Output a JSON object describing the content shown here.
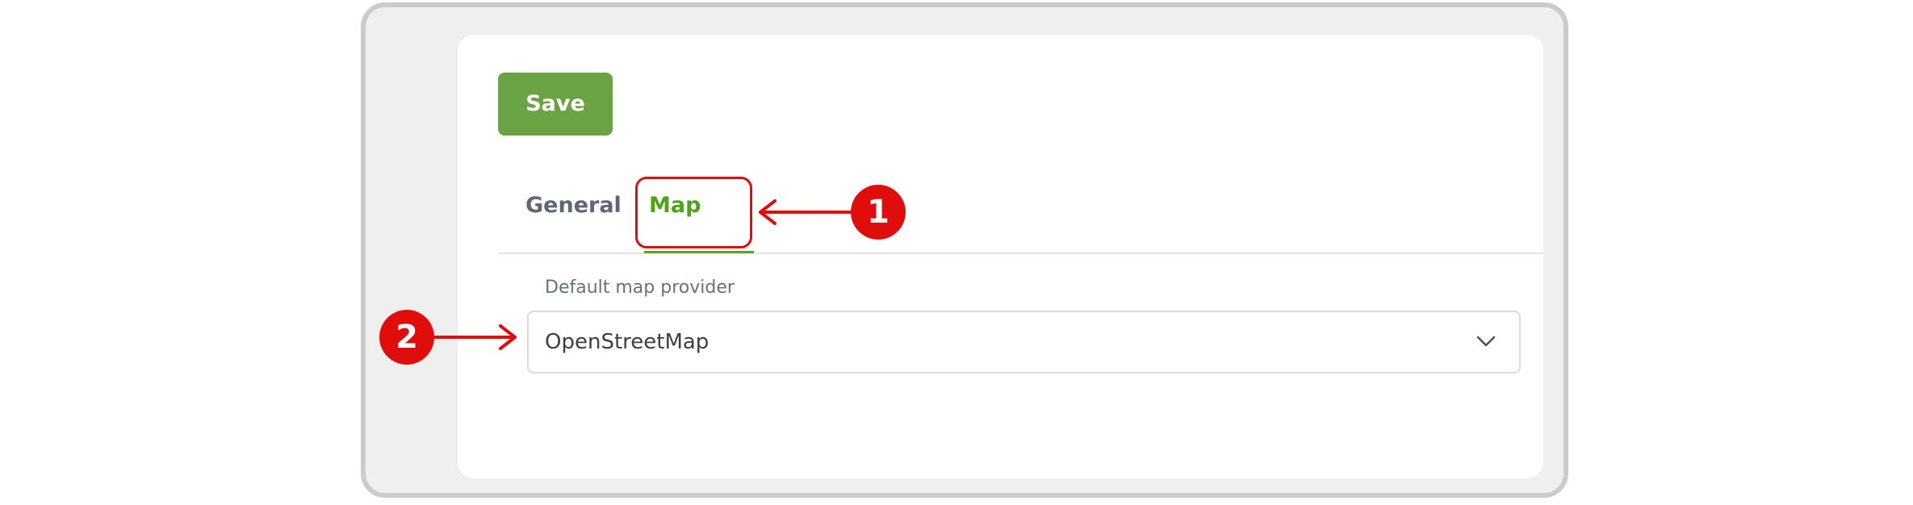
{
  "toolbar": {
    "save_label": "Save"
  },
  "tabs": [
    {
      "label": "General",
      "active": false
    },
    {
      "label": "Map",
      "active": true
    }
  ],
  "map_settings": {
    "provider_label": "Default map provider",
    "provider_value": "OpenStreetMap"
  },
  "annotations": {
    "step_1": "1",
    "step_2": "2"
  },
  "colors": {
    "accent_green": "#6aa343",
    "active_tab_green": "#4fa31c",
    "annotation_red": "#e00d0d"
  },
  "icons": {
    "dropdown": "chevron-down-icon"
  }
}
